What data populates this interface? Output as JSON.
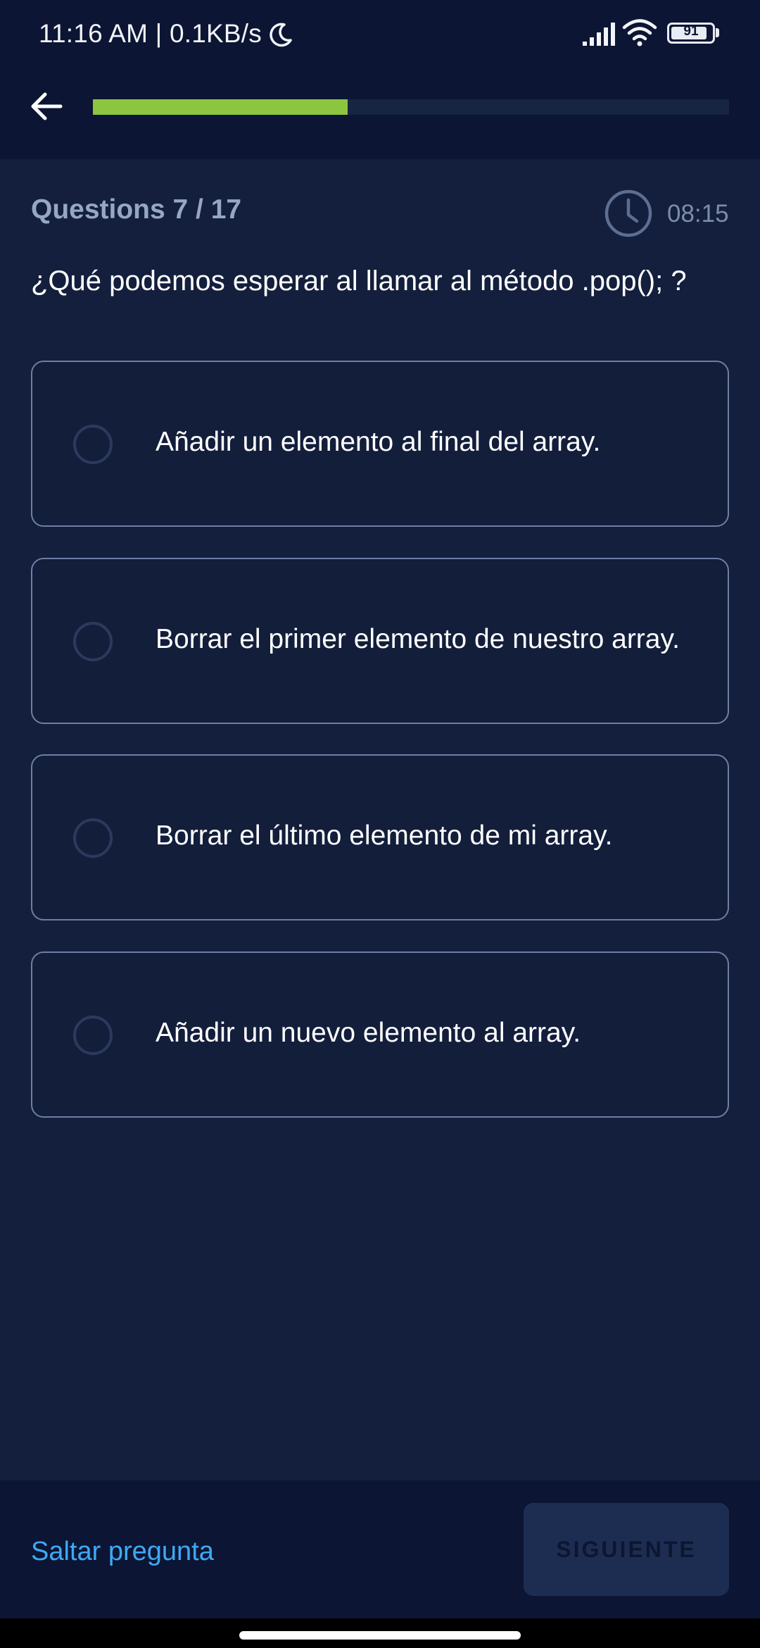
{
  "status_bar": {
    "time_text": "11:16 AM | 0.1KB/s",
    "battery_level": "91",
    "battery_fraction": 0.91
  },
  "header": {
    "progress_fraction": 0.4,
    "progress_color": "#8cc63f"
  },
  "quiz": {
    "question_count": "Questions 7 / 17",
    "timer": "08:15",
    "question": "¿Qué podemos esperar al llamar al método .pop(); ?",
    "options": [
      {
        "label": "Añadir un elemento al final del array."
      },
      {
        "label": "Borrar el primer elemento de nuestro array."
      },
      {
        "label": "Borrar el último elemento de mi array."
      },
      {
        "label": "Añadir un nuevo elemento al array."
      }
    ]
  },
  "footer": {
    "skip_label": "Saltar pregunta",
    "next_label": "SIGUIENTE"
  },
  "icons": {
    "back": "arrow-left-icon",
    "clock": "clock-icon",
    "moon": "moon-icon",
    "signal": "signal-icon",
    "wifi": "wifi-icon"
  },
  "colors": {
    "background": "#131f3c",
    "header_background": "#0c1533",
    "accent": "#8cc63f",
    "link": "#3ea9f5"
  }
}
